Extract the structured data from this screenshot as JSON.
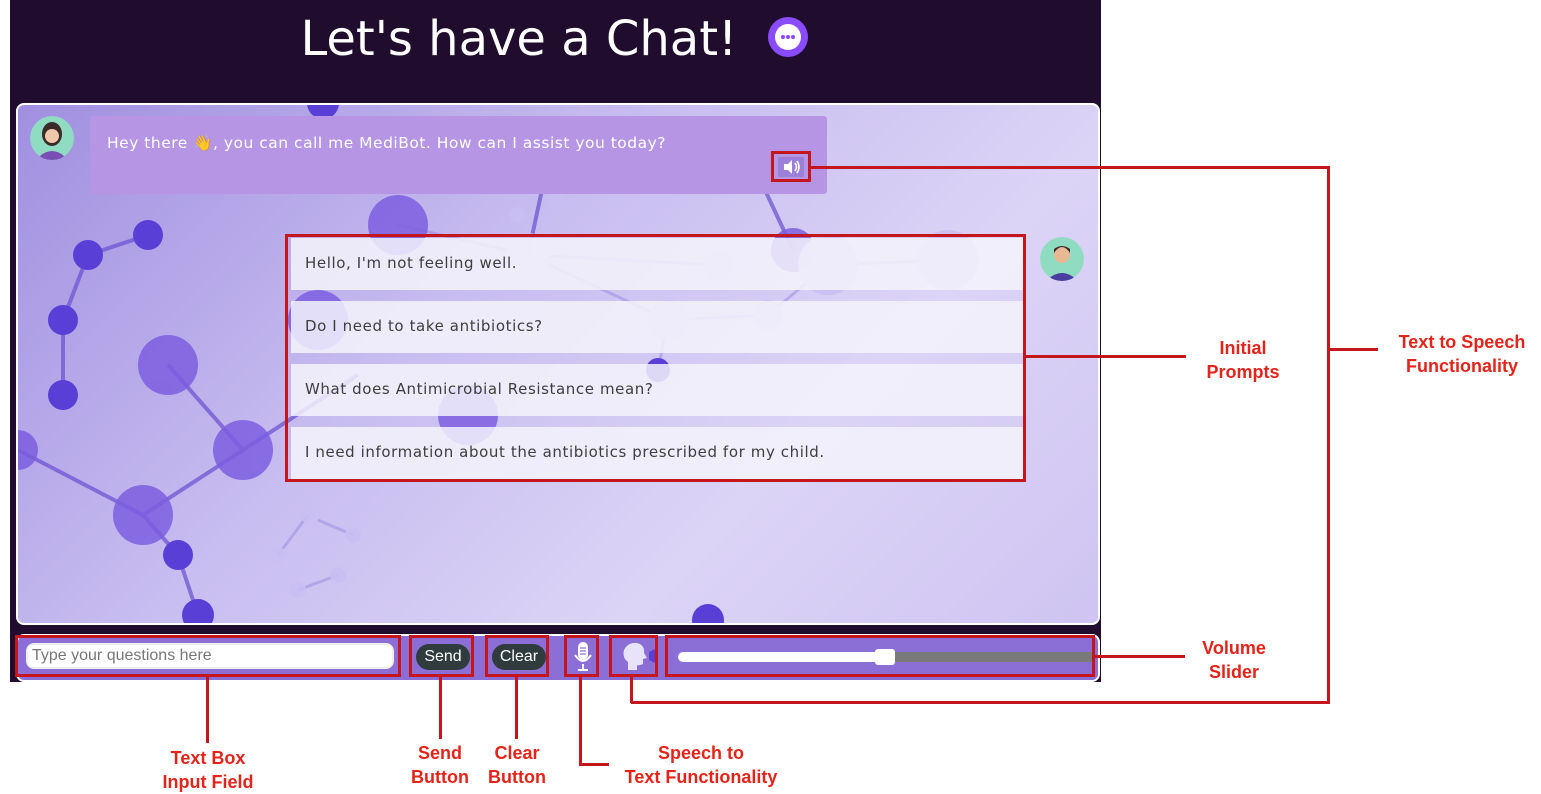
{
  "header": {
    "title": "Let's have a Chat!",
    "icon": "chat-bubble-icon"
  },
  "chat": {
    "bot_message": "Hey there 👋, you can call me MediBot. How can I assist you today?",
    "prompts": [
      "Hello, I'm not feeling well.",
      "Do I need to take antibiotics?",
      "What does Antimicrobial Resistance mean?",
      "I need information about the antibiotics prescribed for my child."
    ]
  },
  "input_bar": {
    "placeholder": "Type your questions here",
    "send_label": "Send",
    "clear_label": "Clear",
    "volume_fraction": 0.5
  },
  "annotations": {
    "text_box": [
      "Text Box",
      "Input Field"
    ],
    "send": [
      "Send",
      "Button"
    ],
    "clear": [
      "Clear",
      "Button"
    ],
    "speech_to_text": [
      "Speech to",
      "Text Functionality"
    ],
    "initial_prompts": [
      "Initial",
      "Prompts"
    ],
    "text_to_speech": [
      "Text to Speech",
      "Functionality"
    ],
    "volume_slider": [
      "Volume",
      "Slider"
    ]
  },
  "colors": {
    "app_background": "#200c2c",
    "bot_bubble": "#b595e4",
    "annotation_red": "#c4161c",
    "button_dark": "#2f3b3c"
  }
}
